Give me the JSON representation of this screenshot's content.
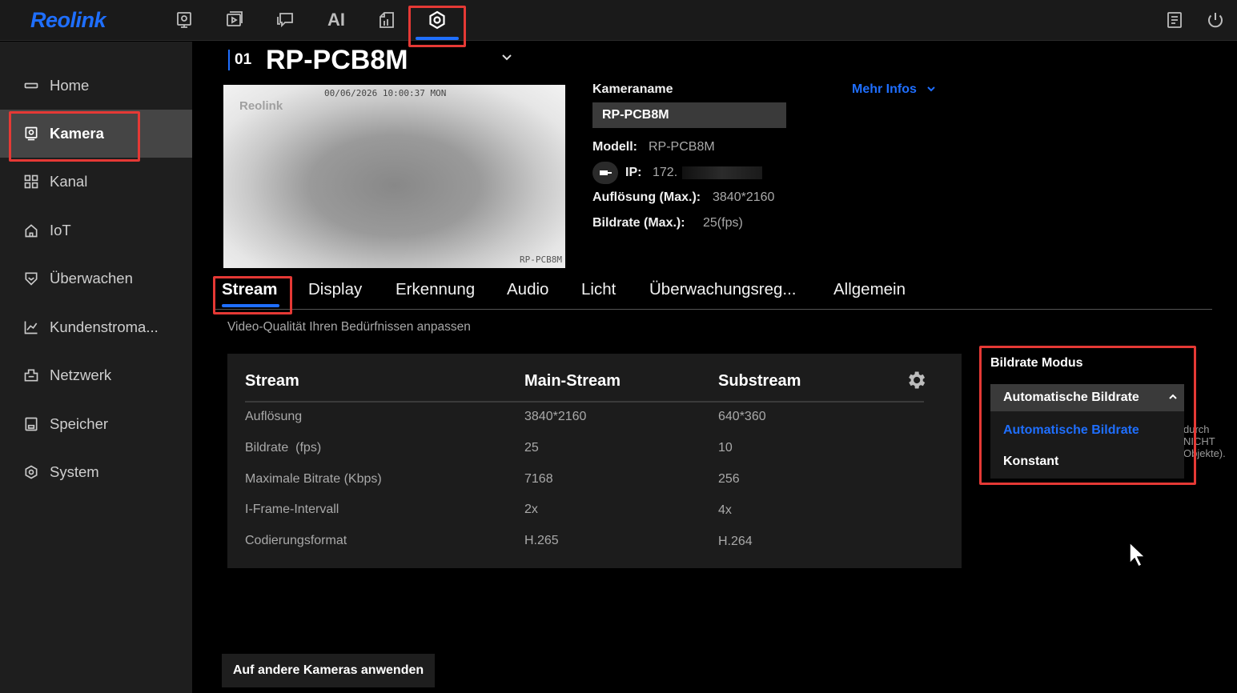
{
  "app": {
    "logo": "Reolink"
  },
  "topbar": {
    "icons": [
      "camera-preview-icon",
      "playback-icon",
      "messages-icon",
      "ai-icon",
      "cloud-files-icon",
      "settings-icon"
    ],
    "ai_label": "AI",
    "right_icons": [
      "notes-icon",
      "power-icon"
    ]
  },
  "sidebar": {
    "items": [
      {
        "label": "Home",
        "icon": "home-icon"
      },
      {
        "label": "Kamera",
        "icon": "camera-icon",
        "selected": true
      },
      {
        "label": "Kanal",
        "icon": "grid-icon"
      },
      {
        "label": "IoT",
        "icon": "iot-icon"
      },
      {
        "label": "Überwachen",
        "icon": "shield-icon"
      },
      {
        "label": "Kundenstroma...",
        "icon": "chart-icon"
      },
      {
        "label": "Netzwerk",
        "icon": "network-icon"
      },
      {
        "label": "Speicher",
        "icon": "storage-icon"
      },
      {
        "label": "System",
        "icon": "system-icon"
      }
    ]
  },
  "camera": {
    "index": "01",
    "title": "RP-PCB8M",
    "preview": {
      "timestamp": "00/06/2026 10:00:37 MON",
      "brand": "Reolink",
      "name_overlay": "RP-PCB8M"
    },
    "info": {
      "name_label": "Kameraname",
      "name_value": "RP-PCB8M",
      "more_info": "Mehr Infos",
      "model_label": "Modell:",
      "model_value": "RP-PCB8M",
      "ip_label": "IP:",
      "ip_value": "172.",
      "resolution_label": "Auflösung (Max.):",
      "resolution_value": "3840*2160",
      "framerate_label": "Bildrate (Max.):",
      "framerate_value": "25(fps)"
    }
  },
  "tabs": [
    "Stream",
    "Display",
    "Erkennung",
    "Audio",
    "Licht",
    "Überwachungsreg...",
    "Allgemein"
  ],
  "active_tab": "Stream",
  "stream": {
    "subtitle": "Video-Qualität Ihren Bedürfnissen anpassen",
    "headers": [
      "Stream",
      "Main-Stream",
      "Substream"
    ],
    "rows": [
      {
        "label": "Auflösung",
        "main": "3840*2160",
        "sub": "640*360"
      },
      {
        "label": "Bildrate  (fps)",
        "main": "25",
        "sub": "10"
      },
      {
        "label": "Maximale Bitrate (Kbps)",
        "main": "7168",
        "sub": "256"
      },
      {
        "label": "I-Frame-Intervall",
        "main": "2x",
        "sub": "4x"
      },
      {
        "label": "Codierungsformat",
        "main": "H.265",
        "sub": "H.264"
      }
    ]
  },
  "bitrate_mode": {
    "title": "Bildrate Modus",
    "selected": "Automatische Bildrate",
    "options": [
      "Automatische Bildrate",
      "Konstant"
    ],
    "behind_text": [
      "durch",
      "NICHT",
      "Objekte)."
    ]
  },
  "apply_button": "Auf andere Kameras anwenden",
  "colors": {
    "accent": "#1f6fff",
    "highlight": "#e53935",
    "sidebar_selected": "#454545"
  }
}
